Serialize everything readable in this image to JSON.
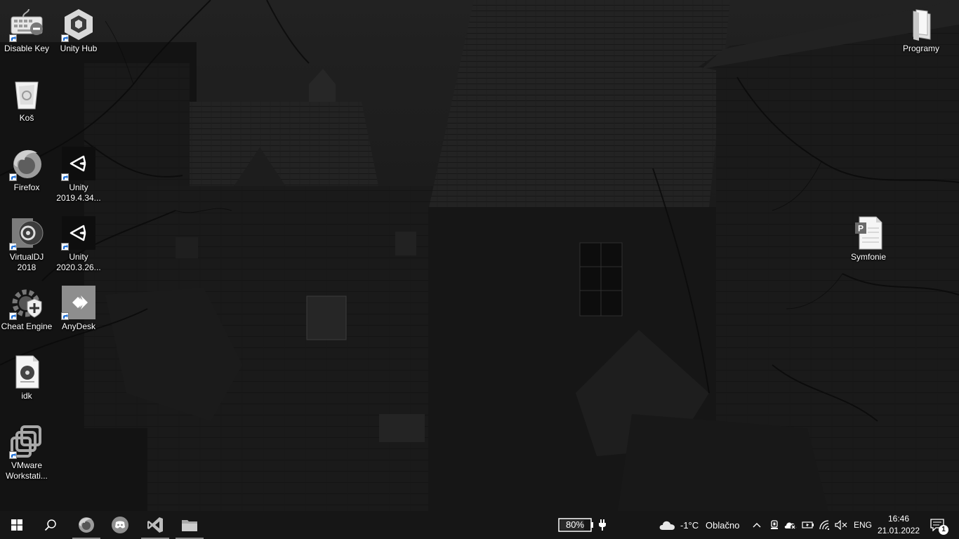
{
  "desktop": {
    "icons": [
      {
        "label": "Disable Key",
        "icon": "keyboard-icon"
      },
      {
        "label": "Unity Hub",
        "icon": "unity-hub-icon"
      },
      {
        "label": "Koš",
        "icon": "recycle-bin-icon"
      },
      {
        "label": "Firefox",
        "icon": "firefox-icon"
      },
      {
        "label": "Unity 2019.4.34...",
        "icon": "unity-icon"
      },
      {
        "label": "VirtualDJ 2018",
        "icon": "virtualdj-icon"
      },
      {
        "label": "Unity 2020.3.26...",
        "icon": "unity-icon"
      },
      {
        "label": "Cheat Engine",
        "icon": "cheat-engine-icon"
      },
      {
        "label": "AnyDesk",
        "icon": "anydesk-icon"
      },
      {
        "label": "idk",
        "icon": "audio-file-icon"
      },
      {
        "label": "VMware Workstati...",
        "icon": "vmware-icon"
      },
      {
        "label": "Programy",
        "icon": "folder-icon"
      },
      {
        "label": "Symfonie",
        "icon": "publisher-file-icon"
      }
    ]
  },
  "taskbar": {
    "pinned": [
      {
        "name": "start",
        "icon": "windows-logo-icon"
      },
      {
        "name": "search",
        "icon": "search-icon"
      },
      {
        "name": "firefox",
        "icon": "firefox-icon",
        "running": true
      },
      {
        "name": "discord",
        "icon": "discord-icon",
        "running": false
      },
      {
        "name": "visual-studio",
        "icon": "visual-studio-icon",
        "running": true
      },
      {
        "name": "file-explorer",
        "icon": "folder-icon",
        "running": true
      }
    ],
    "battery": {
      "percent_label": "80%",
      "level": 0.8,
      "charging": true
    },
    "weather": {
      "temperature": "-1°C",
      "condition": "Oblačno",
      "icon": "cloud-icon"
    },
    "tray_icons": [
      "chevron-up-icon",
      "meet-now-icon",
      "onedrive-icon",
      "battery-icon",
      "wifi-icon",
      "speaker-muted-icon"
    ],
    "language": "ENG",
    "clock": {
      "time": "16:46",
      "date": "21.01.2022"
    },
    "notifications": {
      "count": "1",
      "icon": "notification-center-icon"
    }
  }
}
